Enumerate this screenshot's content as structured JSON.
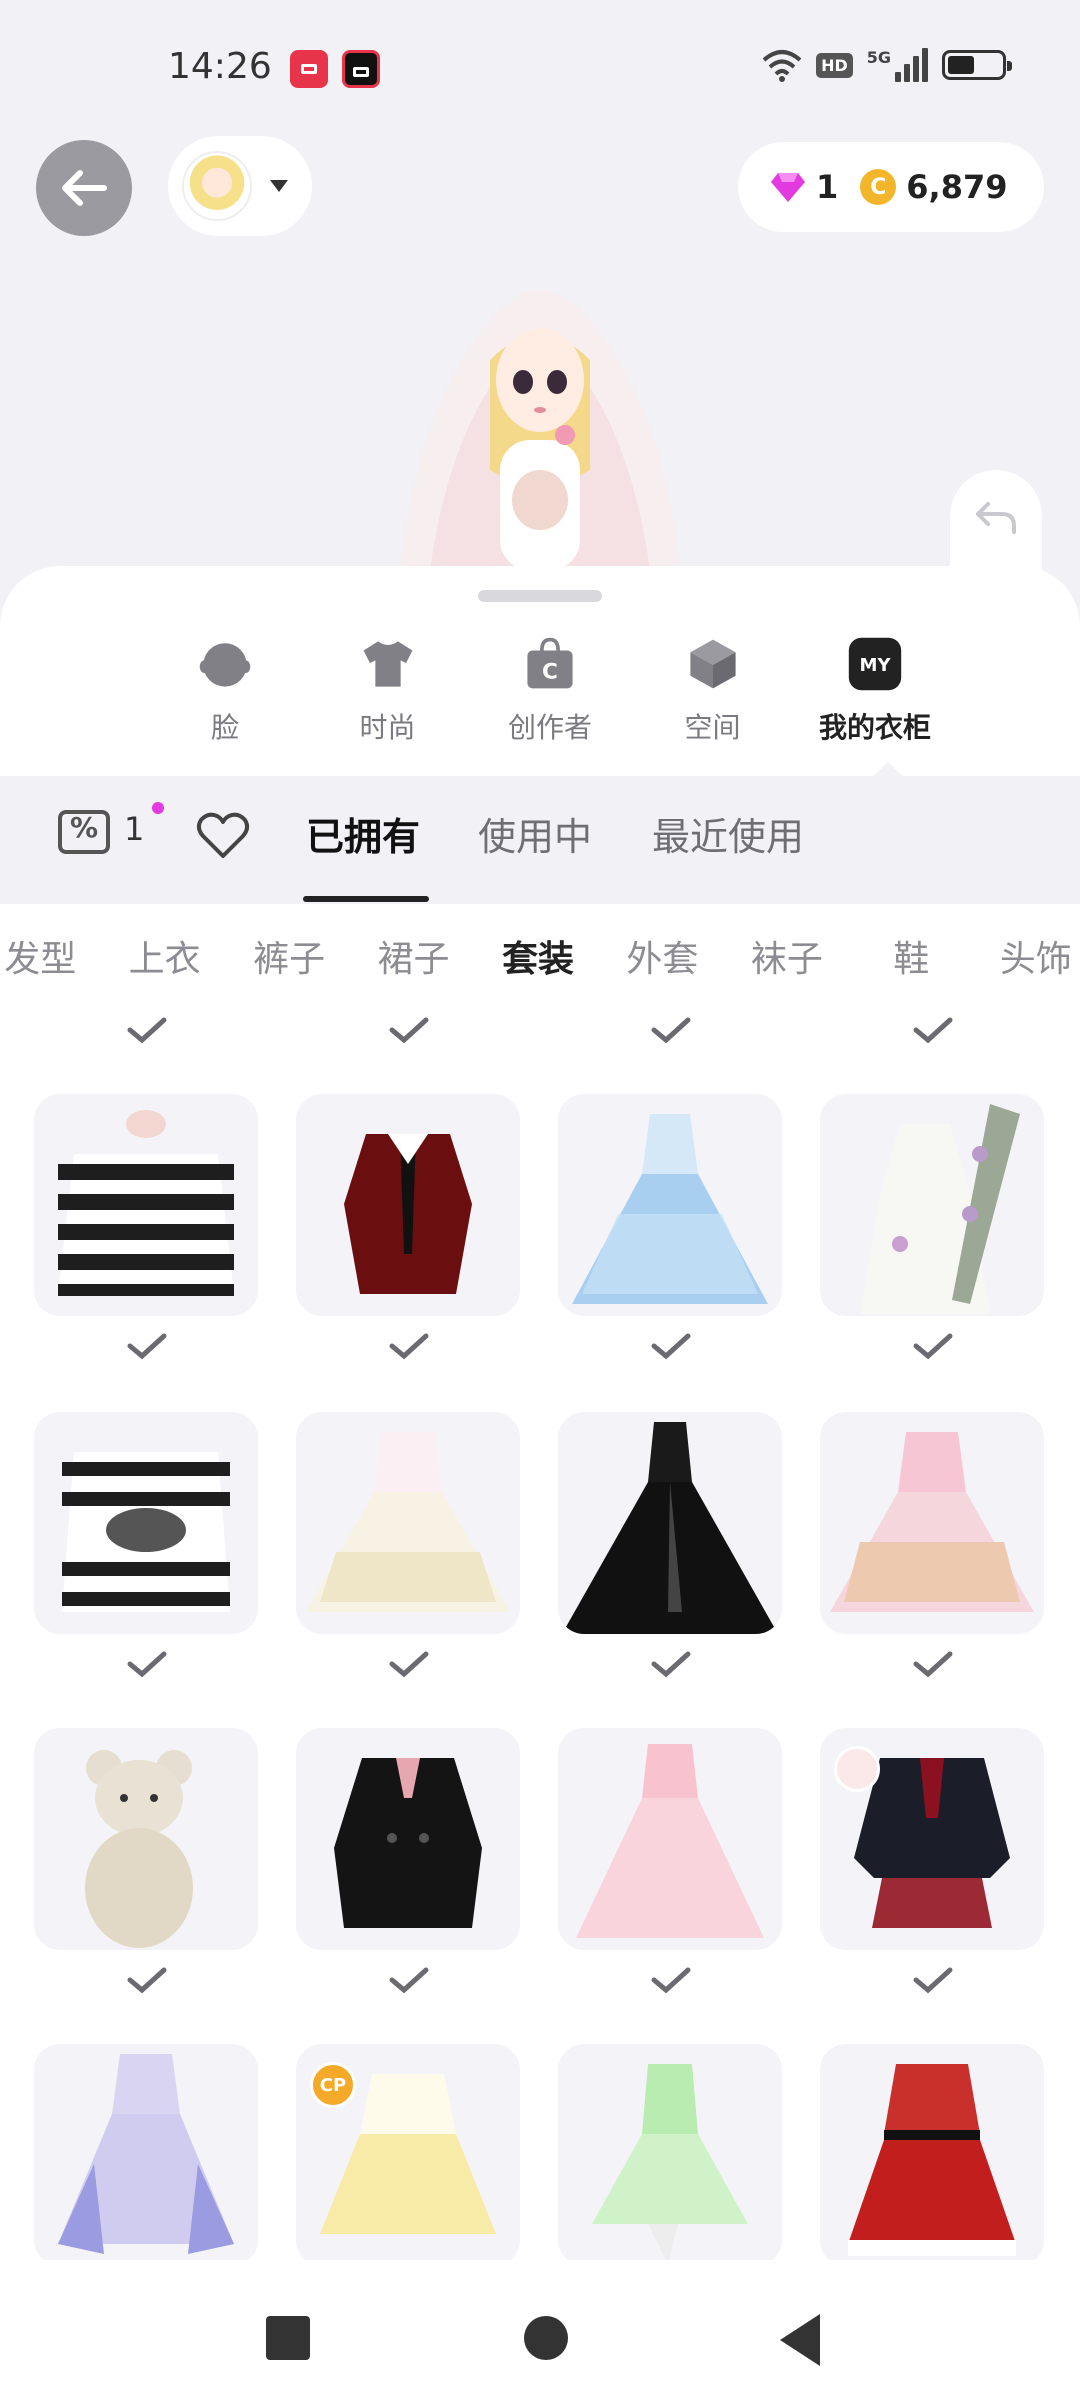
{
  "status": {
    "time": "14:26",
    "hd": "HD",
    "network": "5G"
  },
  "currency": {
    "gems": "1",
    "coins": "6,879",
    "coin_symbol": "C"
  },
  "categories": [
    {
      "label": "脸",
      "icon": "face-icon"
    },
    {
      "label": "时尚",
      "icon": "tshirt-icon"
    },
    {
      "label": "创作者",
      "icon": "creator-bag-icon"
    },
    {
      "label": "空间",
      "icon": "cube-icon"
    },
    {
      "label": "我的衣柜",
      "icon": "my-badge-icon",
      "badge": "MY",
      "active": true
    }
  ],
  "tabs": {
    "coupon_count": "1",
    "items": [
      "已拥有",
      "使用中",
      "最近使用"
    ],
    "active": "已拥有"
  },
  "sub_tabs": {
    "items": [
      "发型",
      "上衣",
      "裤子",
      "裙子",
      "套装",
      "外套",
      "袜子",
      "鞋",
      "头饰"
    ],
    "active": "套装"
  },
  "grid": {
    "items": [
      {
        "name": "striped-sweater-outfit",
        "badge": ""
      },
      {
        "name": "red-uniform-dress",
        "badge": ""
      },
      {
        "name": "blue-ballgown",
        "badge": ""
      },
      {
        "name": "white-harp-dress",
        "badge": ""
      },
      {
        "name": "striped-grunge-top",
        "badge": ""
      },
      {
        "name": "white-lace-dress",
        "badge": ""
      },
      {
        "name": "black-gown",
        "badge": ""
      },
      {
        "name": "pink-lolita-dress",
        "badge": ""
      },
      {
        "name": "teddy-bear-outfit",
        "badge": ""
      },
      {
        "name": "black-trench-coat",
        "badge": ""
      },
      {
        "name": "pink-tulle-gown",
        "badge": ""
      },
      {
        "name": "school-uniform-jacket",
        "badge": "heart"
      },
      {
        "name": "lavender-fairy-dress",
        "badge": ""
      },
      {
        "name": "yellow-sailor-dress",
        "badge": "CP"
      },
      {
        "name": "green-fairy-dress",
        "badge": ""
      },
      {
        "name": "red-christmas-dress",
        "badge": ""
      }
    ]
  },
  "colors": {
    "accent": "#222222",
    "gem": "#E23AE0",
    "coin": "#F3B52A",
    "sheet": "#FFFFFF",
    "tabbar": "#F1F1F6"
  }
}
